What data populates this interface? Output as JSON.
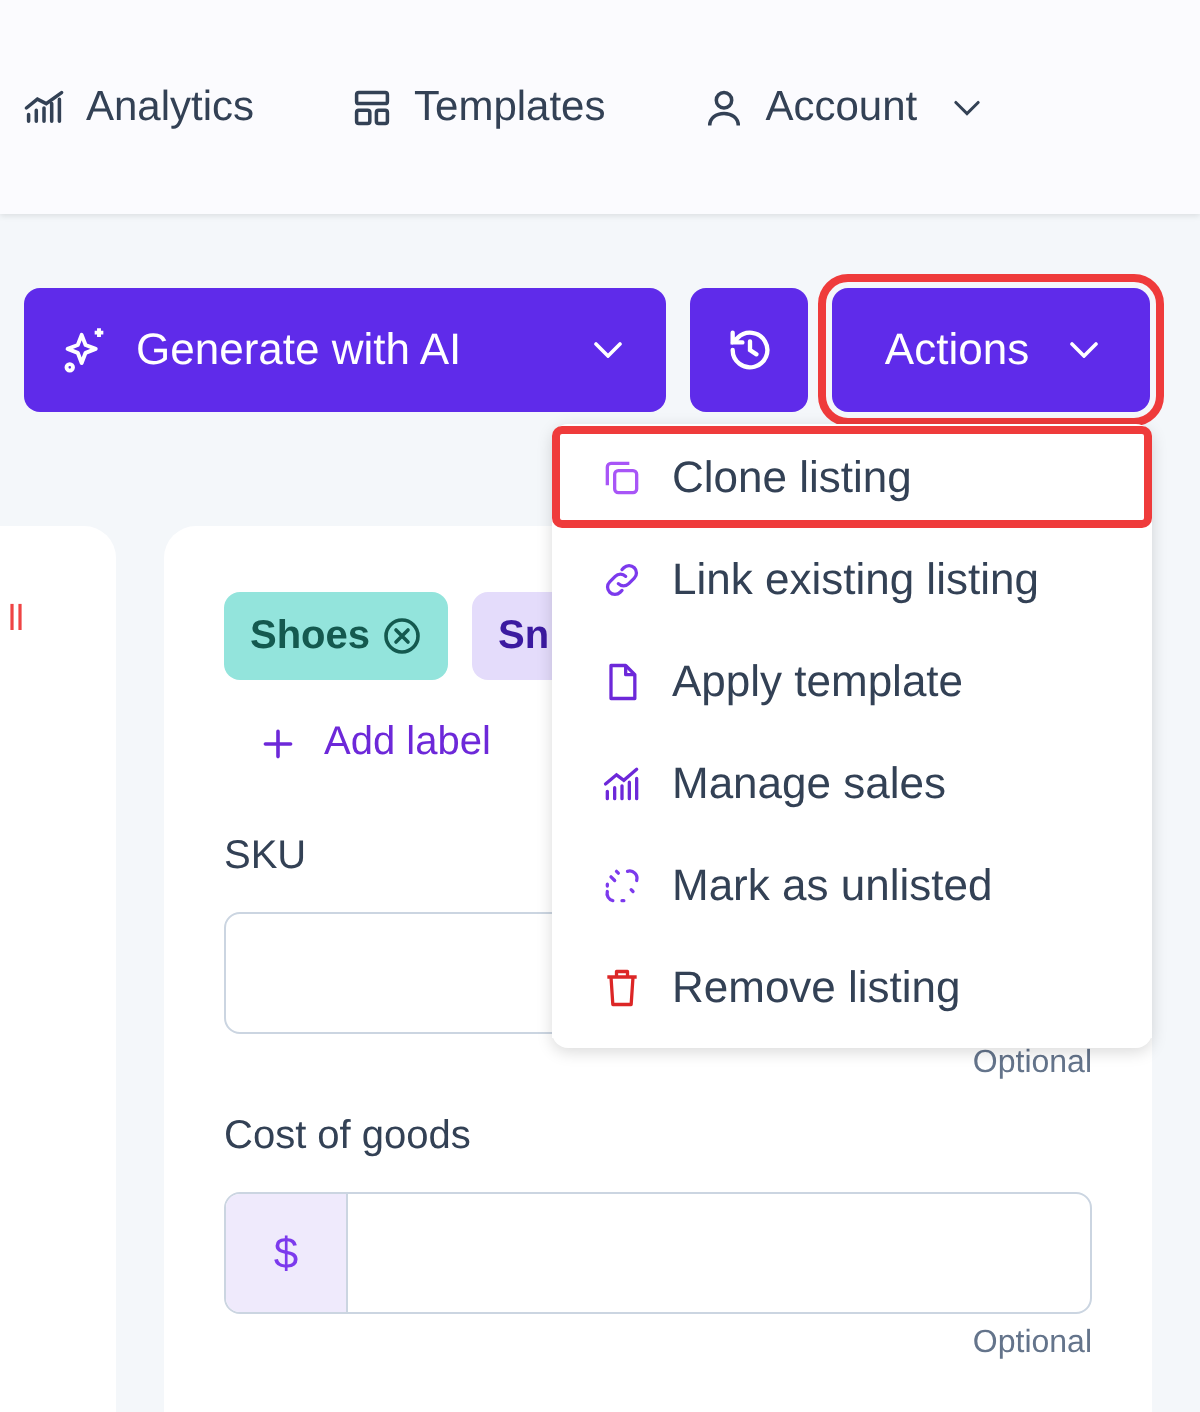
{
  "nav": [
    {
      "kind": "analytics",
      "label": "Analytics",
      "dropdown": false
    },
    {
      "kind": "templates",
      "label": "Templates",
      "dropdown": false
    },
    {
      "kind": "account",
      "label": "Account",
      "dropdown": true
    }
  ],
  "toolbar": {
    "generate_button": {
      "label": "Generate with AI",
      "highlighted": false
    },
    "actions_button": {
      "label": "Actions",
      "highlighted": true,
      "expanded": true
    }
  },
  "actions_menu": [
    {
      "kind": "clone",
      "label": "Clone listing",
      "highlighted": true
    },
    {
      "kind": "link",
      "label": "Link existing listing",
      "highlighted": false
    },
    {
      "kind": "template",
      "label": "Apply template",
      "highlighted": false
    },
    {
      "kind": "sales",
      "label": "Manage sales",
      "highlighted": false
    },
    {
      "kind": "unlist",
      "label": "Mark as unlisted",
      "highlighted": false
    },
    {
      "kind": "remove",
      "label": "Remove listing",
      "highlighted": false
    }
  ],
  "side_card": {
    "text": "ll"
  },
  "listing_card": {
    "tags": [
      {
        "label": "Shoes",
        "color": "#93e4dc",
        "removable": true
      },
      {
        "label": "Sn",
        "color": "#e4dcfb",
        "removable": false
      }
    ],
    "add_label": "Add label",
    "fields": [
      {
        "label": "SKU",
        "hint": "Optional"
      },
      {
        "label": "Cost of goods",
        "prefix": "$",
        "hint": "Optional"
      }
    ]
  }
}
